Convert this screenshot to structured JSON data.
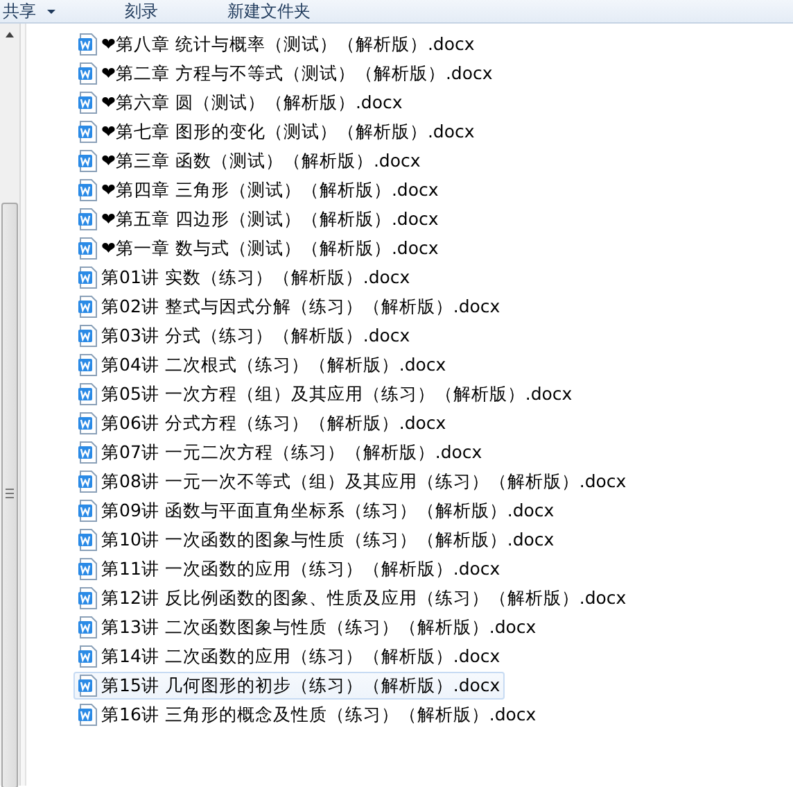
{
  "toolbar": {
    "buttons": [
      {
        "label": "共享",
        "has_menu": true
      },
      {
        "label": "刻录",
        "has_menu": false
      },
      {
        "label": "新建文件夹",
        "has_menu": false
      }
    ]
  },
  "files": [
    {
      "name": "❤第八章 统计与概率（测试）（解析版）.docx",
      "selected": false
    },
    {
      "name": "❤第二章 方程与不等式（测试）（解析版）.docx",
      "selected": false
    },
    {
      "name": "❤第六章  圆（测试）（解析版）.docx",
      "selected": false
    },
    {
      "name": "❤第七章  图形的变化（测试）（解析版）.docx",
      "selected": false
    },
    {
      "name": "❤第三章  函数（测试）（解析版）.docx",
      "selected": false
    },
    {
      "name": "❤第四章  三角形（测试）（解析版）.docx",
      "selected": false
    },
    {
      "name": "❤第五章  四边形（测试）（解析版）.docx",
      "selected": false
    },
    {
      "name": "❤第一章 数与式（测试）（解析版）.docx",
      "selected": false
    },
    {
      "name": "第01讲 实数（练习）（解析版）.docx",
      "selected": false
    },
    {
      "name": "第02讲 整式与因式分解（练习）（解析版）.docx",
      "selected": false
    },
    {
      "name": "第03讲 分式（练习）（解析版）.docx",
      "selected": false
    },
    {
      "name": "第04讲 二次根式（练习）（解析版）.docx",
      "selected": false
    },
    {
      "name": "第05讲 一次方程（组）及其应用（练习）（解析版）.docx",
      "selected": false
    },
    {
      "name": "第06讲 分式方程（练习）（解析版）.docx",
      "selected": false
    },
    {
      "name": "第07讲 一元二次方程（练习）（解析版）.docx",
      "selected": false
    },
    {
      "name": "第08讲 一元一次不等式（组）及其应用（练习）（解析版）.docx",
      "selected": false
    },
    {
      "name": "第09讲 函数与平面直角坐标系（练习）（解析版）.docx",
      "selected": false
    },
    {
      "name": "第10讲 一次函数的图象与性质（练习）（解析版）.docx",
      "selected": false
    },
    {
      "name": "第11讲 一次函数的应用（练习）（解析版）.docx",
      "selected": false
    },
    {
      "name": "第12讲 反比例函数的图象、性质及应用（练习）（解析版）.docx",
      "selected": false
    },
    {
      "name": "第13讲 二次函数图象与性质（练习）（解析版）.docx",
      "selected": false
    },
    {
      "name": "第14讲 二次函数的应用（练习）（解析版）.docx",
      "selected": false
    },
    {
      "name": "第15讲 几何图形的初步（练习）（解析版）.docx",
      "selected": true
    },
    {
      "name": "第16讲 三角形的概念及性质（练习）（解析版）.docx",
      "selected": false
    }
  ]
}
